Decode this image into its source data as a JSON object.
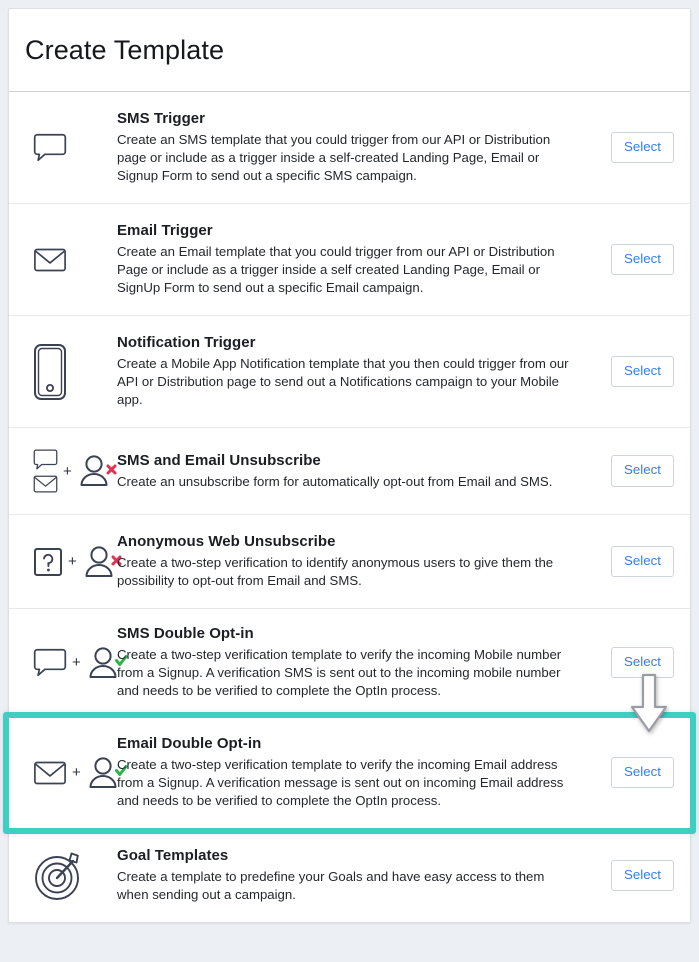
{
  "page": {
    "title": "Create Template",
    "accent_teal": "#3ecfc3",
    "link_blue": "#2f80f0",
    "background": "#eceff3"
  },
  "select_label": "Select",
  "templates": [
    {
      "id": "sms-trigger",
      "title": "SMS Trigger",
      "description": "Create an SMS template that you could trigger from our API or Distribution page or include as a trigger inside a self-created Landing Page, Email or Signup Form to send out a specific SMS campaign.",
      "icons": [
        "speech-bubble-icon"
      ],
      "select_label": "Select",
      "highlighted": false
    },
    {
      "id": "email-trigger",
      "title": "Email Trigger",
      "description": "Create an Email template that you could trigger from our API or Distribution Page or include as a trigger inside a self created Landing Page, Email or SignUp Form to send out a specific Email campaign.",
      "icons": [
        "envelope-icon"
      ],
      "select_label": "Select",
      "highlighted": false
    },
    {
      "id": "notification-trigger",
      "title": "Notification Trigger",
      "description": "Create a Mobile App Notification template that you then could trigger from our API or Distribution page to send out a Notifications campaign to your Mobile app.",
      "icons": [
        "mobile-phone-icon"
      ],
      "select_label": "Select",
      "highlighted": false
    },
    {
      "id": "sms-and-email-unsubscribe",
      "title": "SMS and Email Unsubscribe",
      "description": "Create an unsubscribe form for automatically opt-out from Email and SMS.",
      "icons": [
        "speech-bubble-icon",
        "envelope-icon",
        "plus-sign",
        "person-remove-icon"
      ],
      "select_label": "Select",
      "highlighted": false
    },
    {
      "id": "anonymous-web-unsubscribe",
      "title": "Anonymous Web Unsubscribe",
      "description": "Create a two-step verification to identify anonymous users to give them the possibility to opt-out from Email and SMS.",
      "icons": [
        "question-box-icon",
        "plus-sign",
        "person-remove-icon"
      ],
      "select_label": "Select",
      "highlighted": false
    },
    {
      "id": "sms-double-opt-in",
      "title": "SMS Double Opt-in",
      "description": "Create a two-step verification template to verify the incoming Mobile number from a Signup. A verification SMS is sent out to the incoming mobile number and needs to be verified to complete the OptIn process.",
      "icons": [
        "speech-bubble-icon",
        "plus-sign",
        "person-verified-icon"
      ],
      "select_label": "Select",
      "highlighted": false
    },
    {
      "id": "email-double-opt-in",
      "title": "Email Double Opt-in",
      "description": "Create a two-step verification template to verify the incoming Email address from a Signup. A verification message is sent out on incoming Email address and needs to be verified to complete the OptIn process.",
      "icons": [
        "envelope-icon",
        "plus-sign",
        "person-verified-icon"
      ],
      "select_label": "Select",
      "highlighted": true
    },
    {
      "id": "goal-templates",
      "title": "Goal Templates",
      "description": "Create a template to predefine your Goals and have easy access to them when sending out a campaign.",
      "icons": [
        "target-dart-icon"
      ],
      "select_label": "Select",
      "highlighted": false
    }
  ],
  "annotations": {
    "cursor_arrow": "down-arrow-cursor",
    "highlight_target": "email-double-opt-in"
  }
}
